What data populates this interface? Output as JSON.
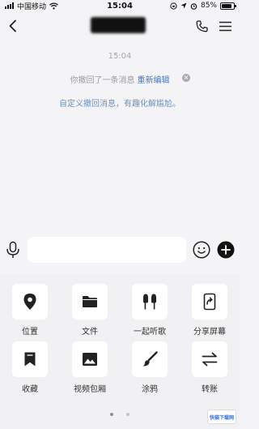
{
  "status_bar": {
    "carrier": "中国移动",
    "time": "15:04",
    "battery": "85%",
    "battery_level": 0.85
  },
  "chat": {
    "timestamp": "15:04",
    "recall_notice": "你撤回了一条消息",
    "recall_edit": "重新编辑",
    "recall_tip": "自定义撤回消息，有趣化解尴尬。"
  },
  "input": {
    "value": "",
    "placeholder": ""
  },
  "panel": {
    "items": [
      {
        "label": "位置",
        "icon": "location-icon"
      },
      {
        "label": "文件",
        "icon": "folder-icon"
      },
      {
        "label": "一起听歌",
        "icon": "earphones-icon"
      },
      {
        "label": "分享屏幕",
        "icon": "share-screen-icon"
      },
      {
        "label": "收藏",
        "icon": "bookmark-icon"
      },
      {
        "label": "视频包厢",
        "icon": "video-room-icon"
      },
      {
        "label": "涂鸦",
        "icon": "brush-icon"
      },
      {
        "label": "转账",
        "icon": "transfer-icon"
      }
    ],
    "page_count": 2,
    "active_page": 1
  },
  "watermark": {
    "text": "快猫下载网"
  }
}
